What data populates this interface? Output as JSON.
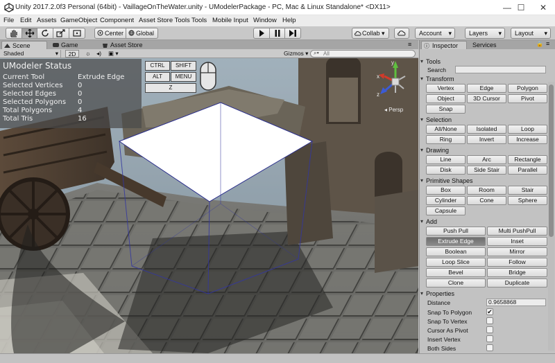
{
  "window": {
    "title": "Unity 2017.2.0f3 Personal (64bit) - VaillageOnTheWater.unity - UModelerPackage - PC, Mac & Linux Standalone* <DX11>",
    "minimize": "—",
    "maximize": "☐",
    "close": "✕"
  },
  "menu": [
    "File",
    "Edit",
    "Assets",
    "GameObject",
    "Component",
    "Asset Store Tools",
    "Tools",
    "Mobile Input",
    "Window",
    "Help"
  ],
  "toolbar": {
    "tools": [
      "hand-tool",
      "move-tool",
      "rotate-tool",
      "scale-tool",
      "rect-tool"
    ],
    "pivot_label": "Center",
    "space_label": "Global",
    "collab_label": "Collab ▾",
    "account_label": "Account",
    "layers_label": "Layers",
    "layout_label": "Layout"
  },
  "scene_tabs": {
    "scene": "Scene",
    "game": "Game",
    "asset_store": "Asset Store"
  },
  "scene_bar": {
    "shading": "Shaded",
    "mode_2d": "2D",
    "gizmos": "Gizmos",
    "search_placeholder": "All"
  },
  "status": {
    "title": "UModeler Status",
    "rows": [
      {
        "label": "Current Tool",
        "value": "Extrude Edge"
      },
      {
        "label": "Selected Vertices",
        "value": "0"
      },
      {
        "label": "Selected Edges",
        "value": "0"
      },
      {
        "label": "Selected Polygons",
        "value": "0"
      },
      {
        "label": "Total Polygons",
        "value": "4"
      },
      {
        "label": "Total Tris",
        "value": "16"
      }
    ]
  },
  "keys": {
    "ctrl": "CTRL",
    "shift": "SHIFT",
    "alt": "ALT",
    "menu": "MENU",
    "z": "Z"
  },
  "gizmo": {
    "x": "x",
    "y": "y",
    "z": "z",
    "persp": "Persp"
  },
  "inspector": {
    "tab_inspector": "Inspector",
    "tab_services": "Services",
    "tools_header": "Tools",
    "search_label": "Search",
    "transform": {
      "header": "Transform",
      "buttons": [
        "Vertex",
        "Edge",
        "Polygon",
        "Object",
        "3D Cursor",
        "Pivot",
        "Snap"
      ]
    },
    "selection": {
      "header": "Selection",
      "buttons": [
        "All/None",
        "Isolated",
        "Loop",
        "Ring",
        "Invert",
        "Increase"
      ]
    },
    "drawing": {
      "header": "Drawing",
      "buttons": [
        "Line",
        "Arc",
        "Rectangle",
        "Disk",
        "Side Stair",
        "Parallel"
      ]
    },
    "primitives": {
      "header": "Primitive Shapes",
      "buttons": [
        "Box",
        "Room",
        "Stair",
        "Cylinder",
        "Cone",
        "Sphere",
        "Capsule"
      ]
    },
    "add": {
      "header": "Add",
      "buttons": [
        "Push Pull",
        "Multi PushPull",
        "Extrude Edge",
        "Inset",
        "Boolean",
        "Mirror",
        "Loop Slice",
        "Follow",
        "Bevel",
        "Bridge",
        "Clone",
        "Duplicate"
      ]
    },
    "properties": {
      "header": "Properties",
      "distance_label": "Distance",
      "distance_value": "0.9658868",
      "checks": [
        {
          "label": "Snap To Polygon",
          "checked": true
        },
        {
          "label": "Snap To Vertex",
          "checked": false
        },
        {
          "label": "Cursor As Pivot",
          "checked": false
        },
        {
          "label": "Insert Vertex",
          "checked": false
        },
        {
          "label": "Both Sides",
          "checked": false
        }
      ]
    }
  }
}
